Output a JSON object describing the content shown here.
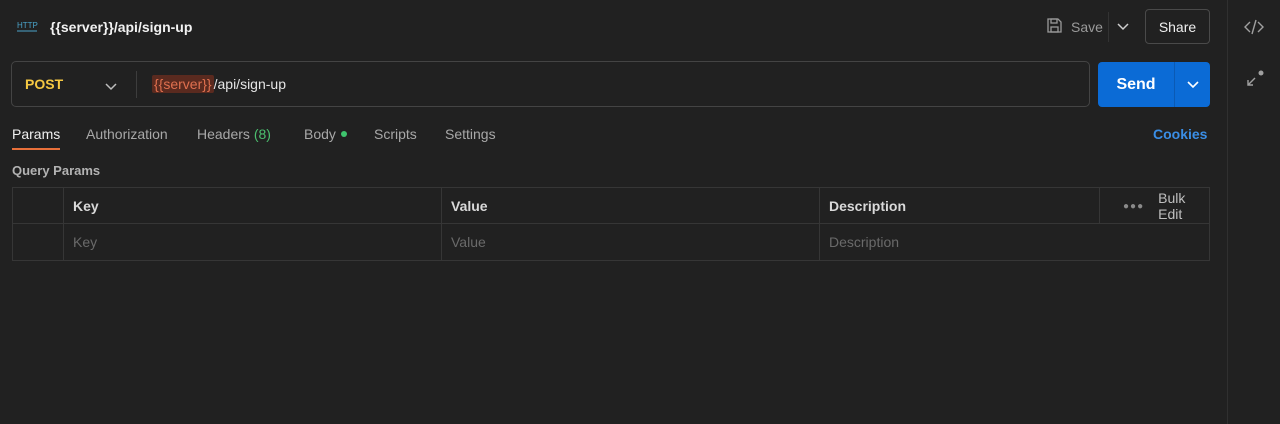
{
  "request": {
    "title": "{{server}}/api/sign-up",
    "method": "POST",
    "url_variable": "{{server}}",
    "url_path": "/api/sign-up"
  },
  "header": {
    "save_label": "Save",
    "share_label": "Share",
    "http_icon": "http-icon"
  },
  "send": {
    "label": "Send"
  },
  "tabs": [
    {
      "label": "Params",
      "active": true
    },
    {
      "label": "Authorization"
    },
    {
      "label": "Headers",
      "count": "(8)"
    },
    {
      "label": "Body",
      "indicator": "green-dot"
    },
    {
      "label": "Scripts"
    },
    {
      "label": "Settings"
    }
  ],
  "cookies_label": "Cookies",
  "query_params": {
    "title": "Query Params",
    "columns": [
      "Key",
      "Value",
      "Description"
    ],
    "bulk_edit_label": "Bulk Edit",
    "placeholders": {
      "key": "Key",
      "value": "Value",
      "description": "Description"
    }
  },
  "colors": {
    "method": "#f5c842",
    "accent_tab": "#e8703a",
    "send": "#0b6bd6",
    "link": "#3a8ee6",
    "variable": "#e0704f"
  }
}
